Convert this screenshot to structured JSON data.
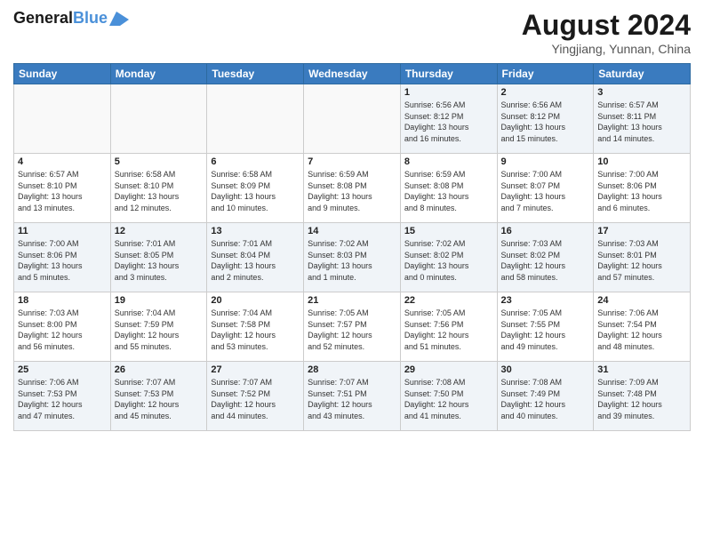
{
  "logo": {
    "text1": "General",
    "text2": "Blue"
  },
  "title": "August 2024",
  "location": "Yingjiang, Yunnan, China",
  "headers": [
    "Sunday",
    "Monday",
    "Tuesday",
    "Wednesday",
    "Thursday",
    "Friday",
    "Saturday"
  ],
  "weeks": [
    [
      {
        "day": "",
        "info": ""
      },
      {
        "day": "",
        "info": ""
      },
      {
        "day": "",
        "info": ""
      },
      {
        "day": "",
        "info": ""
      },
      {
        "day": "1",
        "info": "Sunrise: 6:56 AM\nSunset: 8:12 PM\nDaylight: 13 hours\nand 16 minutes."
      },
      {
        "day": "2",
        "info": "Sunrise: 6:56 AM\nSunset: 8:12 PM\nDaylight: 13 hours\nand 15 minutes."
      },
      {
        "day": "3",
        "info": "Sunrise: 6:57 AM\nSunset: 8:11 PM\nDaylight: 13 hours\nand 14 minutes."
      }
    ],
    [
      {
        "day": "4",
        "info": "Sunrise: 6:57 AM\nSunset: 8:10 PM\nDaylight: 13 hours\nand 13 minutes."
      },
      {
        "day": "5",
        "info": "Sunrise: 6:58 AM\nSunset: 8:10 PM\nDaylight: 13 hours\nand 12 minutes."
      },
      {
        "day": "6",
        "info": "Sunrise: 6:58 AM\nSunset: 8:09 PM\nDaylight: 13 hours\nand 10 minutes."
      },
      {
        "day": "7",
        "info": "Sunrise: 6:59 AM\nSunset: 8:08 PM\nDaylight: 13 hours\nand 9 minutes."
      },
      {
        "day": "8",
        "info": "Sunrise: 6:59 AM\nSunset: 8:08 PM\nDaylight: 13 hours\nand 8 minutes."
      },
      {
        "day": "9",
        "info": "Sunrise: 7:00 AM\nSunset: 8:07 PM\nDaylight: 13 hours\nand 7 minutes."
      },
      {
        "day": "10",
        "info": "Sunrise: 7:00 AM\nSunset: 8:06 PM\nDaylight: 13 hours\nand 6 minutes."
      }
    ],
    [
      {
        "day": "11",
        "info": "Sunrise: 7:00 AM\nSunset: 8:06 PM\nDaylight: 13 hours\nand 5 minutes."
      },
      {
        "day": "12",
        "info": "Sunrise: 7:01 AM\nSunset: 8:05 PM\nDaylight: 13 hours\nand 3 minutes."
      },
      {
        "day": "13",
        "info": "Sunrise: 7:01 AM\nSunset: 8:04 PM\nDaylight: 13 hours\nand 2 minutes."
      },
      {
        "day": "14",
        "info": "Sunrise: 7:02 AM\nSunset: 8:03 PM\nDaylight: 13 hours\nand 1 minute."
      },
      {
        "day": "15",
        "info": "Sunrise: 7:02 AM\nSunset: 8:02 PM\nDaylight: 13 hours\nand 0 minutes."
      },
      {
        "day": "16",
        "info": "Sunrise: 7:03 AM\nSunset: 8:02 PM\nDaylight: 12 hours\nand 58 minutes."
      },
      {
        "day": "17",
        "info": "Sunrise: 7:03 AM\nSunset: 8:01 PM\nDaylight: 12 hours\nand 57 minutes."
      }
    ],
    [
      {
        "day": "18",
        "info": "Sunrise: 7:03 AM\nSunset: 8:00 PM\nDaylight: 12 hours\nand 56 minutes."
      },
      {
        "day": "19",
        "info": "Sunrise: 7:04 AM\nSunset: 7:59 PM\nDaylight: 12 hours\nand 55 minutes."
      },
      {
        "day": "20",
        "info": "Sunrise: 7:04 AM\nSunset: 7:58 PM\nDaylight: 12 hours\nand 53 minutes."
      },
      {
        "day": "21",
        "info": "Sunrise: 7:05 AM\nSunset: 7:57 PM\nDaylight: 12 hours\nand 52 minutes."
      },
      {
        "day": "22",
        "info": "Sunrise: 7:05 AM\nSunset: 7:56 PM\nDaylight: 12 hours\nand 51 minutes."
      },
      {
        "day": "23",
        "info": "Sunrise: 7:05 AM\nSunset: 7:55 PM\nDaylight: 12 hours\nand 49 minutes."
      },
      {
        "day": "24",
        "info": "Sunrise: 7:06 AM\nSunset: 7:54 PM\nDaylight: 12 hours\nand 48 minutes."
      }
    ],
    [
      {
        "day": "25",
        "info": "Sunrise: 7:06 AM\nSunset: 7:53 PM\nDaylight: 12 hours\nand 47 minutes."
      },
      {
        "day": "26",
        "info": "Sunrise: 7:07 AM\nSunset: 7:53 PM\nDaylight: 12 hours\nand 45 minutes."
      },
      {
        "day": "27",
        "info": "Sunrise: 7:07 AM\nSunset: 7:52 PM\nDaylight: 12 hours\nand 44 minutes."
      },
      {
        "day": "28",
        "info": "Sunrise: 7:07 AM\nSunset: 7:51 PM\nDaylight: 12 hours\nand 43 minutes."
      },
      {
        "day": "29",
        "info": "Sunrise: 7:08 AM\nSunset: 7:50 PM\nDaylight: 12 hours\nand 41 minutes."
      },
      {
        "day": "30",
        "info": "Sunrise: 7:08 AM\nSunset: 7:49 PM\nDaylight: 12 hours\nand 40 minutes."
      },
      {
        "day": "31",
        "info": "Sunrise: 7:09 AM\nSunset: 7:48 PM\nDaylight: 12 hours\nand 39 minutes."
      }
    ]
  ]
}
